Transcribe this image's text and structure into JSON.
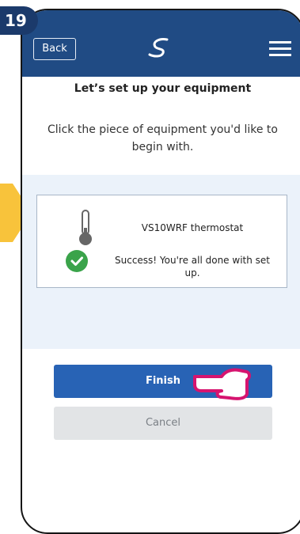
{
  "step_badge": "19",
  "header": {
    "back_label": "Back",
    "logo_icon": "swirl-logo-icon",
    "menu_icon": "hamburger-menu-icon"
  },
  "page": {
    "title": "Let’s set up your equipment",
    "subtitle": "Click the piece of equipment you'd like to begin with."
  },
  "equipment": {
    "device_icon": "thermometer-icon",
    "device_name": "VS10WRF thermostat",
    "status_icon": "check-circle-icon",
    "status_text": "Success! You're all done with set up."
  },
  "actions": {
    "finish_label": "Finish",
    "cancel_label": "Cancel"
  },
  "colors": {
    "header_bg": "#204b84",
    "primary_button": "#2863b5",
    "success_green": "#3aa34a",
    "panel_bg": "#ebf2fa",
    "highlight_arrow": "#f8c33b",
    "hand_outline": "#d6146f"
  }
}
